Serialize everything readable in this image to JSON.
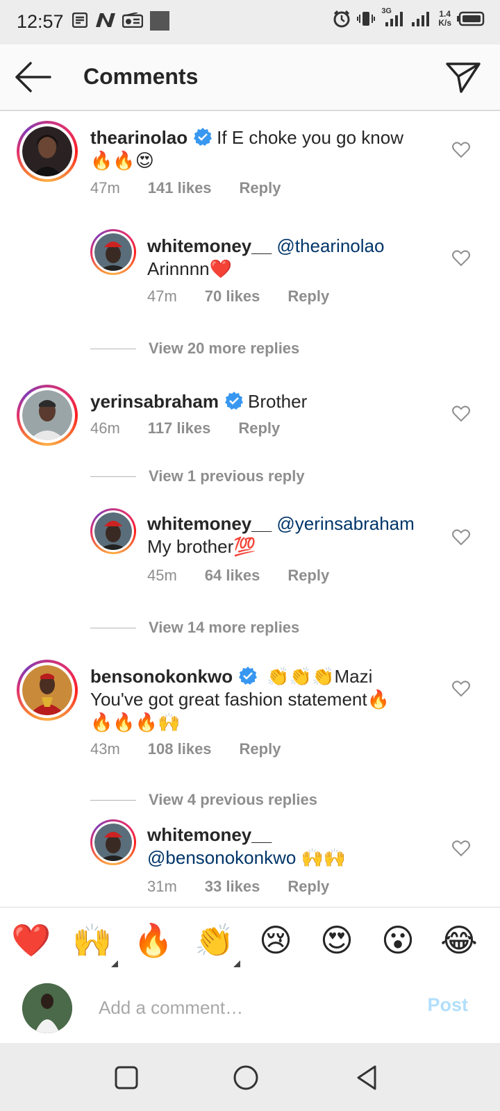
{
  "status_bar": {
    "time": "12:57",
    "network": "3G",
    "speed_value": "1.4",
    "speed_unit": "K/s"
  },
  "header": {
    "title": "Comments"
  },
  "comments": [
    {
      "username": "thearinolao",
      "verified": true,
      "text": "If E choke you go know",
      "emoji": "🔥🔥😍",
      "time": "47m",
      "likes": "141 likes",
      "reply": "Reply"
    },
    {
      "username": "whitemoney__",
      "mention": "@thearinolao",
      "text": "Arinnnn❤️",
      "time": "47m",
      "likes": "70 likes",
      "reply": "Reply"
    },
    {
      "view_replies": "View 20 more replies"
    },
    {
      "username": "yerinsabraham",
      "verified": true,
      "text": "Brother",
      "time": "46m",
      "likes": "117 likes",
      "reply": "Reply"
    },
    {
      "view_replies": "View 1 previous reply"
    },
    {
      "username": "whitemoney__",
      "mention": "@yerinsabraham",
      "text": "My brother💯",
      "time": "45m",
      "likes": "64 likes",
      "reply": "Reply"
    },
    {
      "view_replies": "View 14 more replies"
    },
    {
      "username": "bensonokonkwo",
      "verified": true,
      "text_line1": "👏👏👏Mazi",
      "text_line2": "You've got great fashion statement🔥",
      "text_line3": "🔥🔥🔥🙌",
      "time": "43m",
      "likes": "108 likes",
      "reply": "Reply"
    },
    {
      "view_replies": "View 4 previous replies"
    },
    {
      "username": "whitemoney__",
      "mention": "@bensonokonkwo",
      "text": "🙌🙌",
      "time": "31m",
      "likes": "33 likes",
      "reply": "Reply"
    }
  ],
  "reactions": [
    "❤️",
    "🙌",
    "🔥",
    "👏",
    "😢",
    "😍",
    "😮",
    "😂"
  ],
  "composer": {
    "placeholder": "Add a comment…",
    "post_label": "Post"
  },
  "colors": {
    "link": "#003569",
    "meta": "#8e8e8e",
    "verified": "#3897f0",
    "post_disabled": "#b2dffc"
  }
}
